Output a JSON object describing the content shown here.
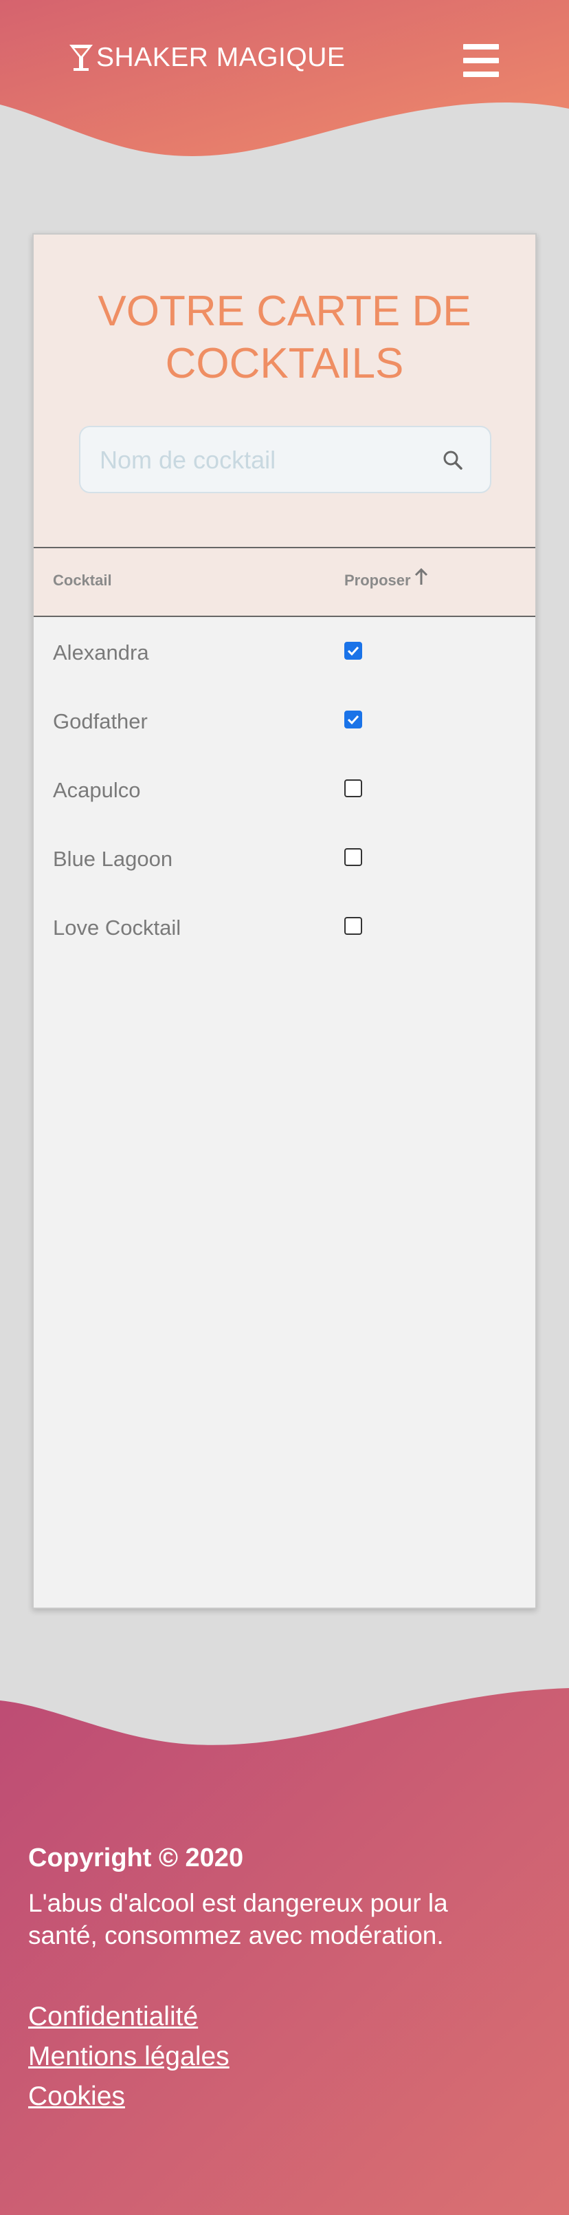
{
  "header": {
    "brand": "SHAKER MAGIQUE",
    "logo_icon": "cocktail-glass-icon",
    "menu_icon": "hamburger-menu-icon"
  },
  "card": {
    "title_line1": "VOTRE CARTE DE",
    "title_line2": "COCKTAILS",
    "search": {
      "placeholder": "Nom de cocktail",
      "value": "",
      "icon": "search-icon"
    },
    "table": {
      "columns": [
        "Cocktail",
        "Proposer"
      ],
      "sort_icon": "arrow-up-icon",
      "rows": [
        {
          "name": "Alexandra",
          "checked": true
        },
        {
          "name": "Godfather",
          "checked": true
        },
        {
          "name": "Acapulco",
          "checked": false
        },
        {
          "name": "Blue Lagoon",
          "checked": false
        },
        {
          "name": "Love Cocktail",
          "checked": false
        }
      ]
    }
  },
  "footer": {
    "copyright": "Copyright © 2020",
    "disclaimer": "L'abus d'alcool est dangereux pour la santé, consommez avec modération.",
    "links": [
      "Confidentialité",
      "Mentions légales",
      "Cookies"
    ]
  },
  "colors": {
    "header_gradient": [
      "#d8666d",
      "#ec8a6c"
    ],
    "footer_gradient": [
      "#bf4f74",
      "#d86f72"
    ],
    "accent": "#ef8e63",
    "card_header_bg": "#f4e8e3",
    "checkbox_checked": "#1a73e8"
  }
}
